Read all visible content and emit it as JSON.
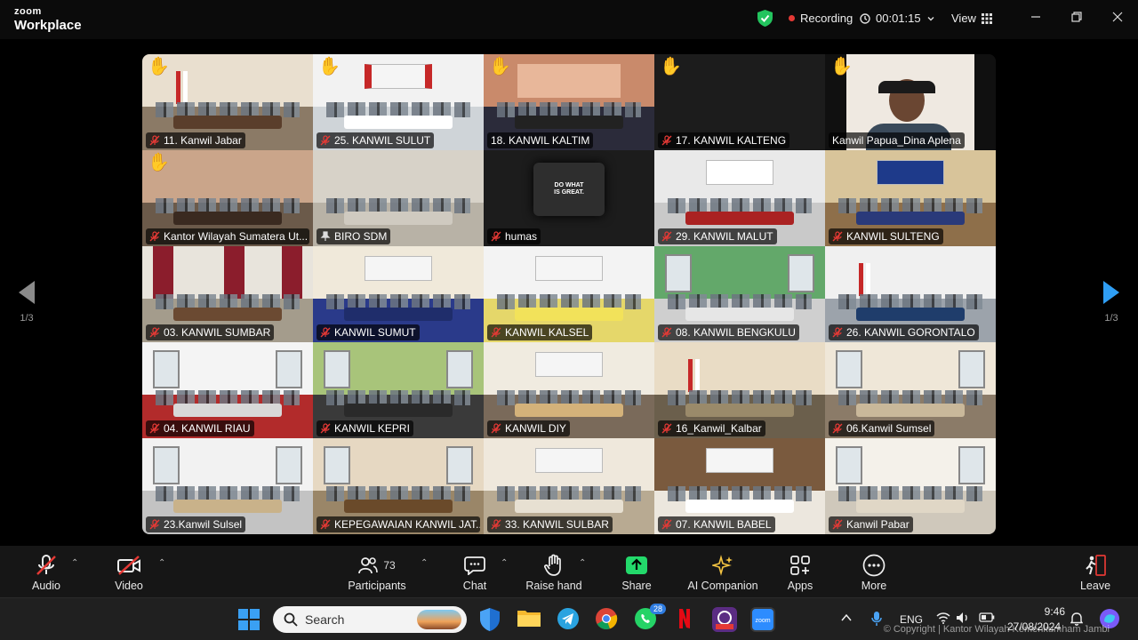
{
  "titlebar": {
    "brand_line1": "zoom",
    "brand_line2": "Workplace",
    "recording_label": "Recording",
    "timer": "00:01:15",
    "view_label": "View"
  },
  "gallery": {
    "pager_left": "1/3",
    "pager_right": "1/3",
    "tiles": [
      {
        "name": "11. Kanwil Jabar",
        "hand": true,
        "muted": true
      },
      {
        "name": "25. KANWIL SULUT",
        "hand": true,
        "muted": true
      },
      {
        "name": "18. KANWIL KALTIM",
        "hand": true,
        "muted": false,
        "active": true
      },
      {
        "name": "17. KANWIL KALTENG",
        "hand": true,
        "muted": true
      },
      {
        "name": "Kanwil Papua_Dina Aplena",
        "hand": true,
        "muted": false
      },
      {
        "name": "Kantor Wilayah Sumatera Ut...",
        "hand": true,
        "muted": true
      },
      {
        "name": "BIRO SDM",
        "hand": false,
        "muted": false,
        "pinned": true
      },
      {
        "name": "humas",
        "hand": false,
        "muted": true
      },
      {
        "name": "29. KANWIL MALUT",
        "hand": false,
        "muted": true
      },
      {
        "name": "KANWIL SULTENG",
        "hand": false,
        "muted": true
      },
      {
        "name": "03. KANWIL SUMBAR",
        "hand": false,
        "muted": true
      },
      {
        "name": "KANWIL SUMUT",
        "hand": false,
        "muted": true
      },
      {
        "name": "KANWIL KALSEL",
        "hand": false,
        "muted": true
      },
      {
        "name": "08. KANWIL BENGKULU",
        "hand": false,
        "muted": true
      },
      {
        "name": "26. KANWIL GORONTALO",
        "hand": false,
        "muted": true
      },
      {
        "name": "04. KANWIL RIAU",
        "hand": false,
        "muted": true
      },
      {
        "name": "KANWIL KEPRI",
        "hand": false,
        "muted": true
      },
      {
        "name": "KANWIL DIY",
        "hand": false,
        "muted": true
      },
      {
        "name": "16_Kanwil_Kalbar",
        "hand": false,
        "muted": true
      },
      {
        "name": "06.Kanwil Sumsel",
        "hand": false,
        "muted": true
      },
      {
        "name": "23.Kanwil Sulsel",
        "hand": false,
        "muted": true
      },
      {
        "name": "KEPEGAWAIAN KANWIL JAT...",
        "hand": false,
        "muted": true
      },
      {
        "name": "33. KANWIL SULBAR",
        "hand": false,
        "muted": true
      },
      {
        "name": "07. KANWIL BABEL",
        "hand": false,
        "muted": true
      },
      {
        "name": "Kanwil Pabar",
        "hand": false,
        "muted": true
      }
    ],
    "humas_screen_text": "DO WHAT IS GREAT."
  },
  "toolbar": {
    "audio": "Audio",
    "video": "Video",
    "participants": "Participants",
    "participants_count": "73",
    "chat": "Chat",
    "raise_hand": "Raise hand",
    "share": "Share",
    "ai_companion": "AI Companion",
    "apps": "Apps",
    "more": "More",
    "leave": "Leave"
  },
  "taskbar": {
    "search_placeholder": "Search",
    "whatsapp_badge": "28",
    "lang": "ENG",
    "time": "9:46",
    "date": "27/08/2024",
    "watermark": "© Copyright | Kantor Wilayah Kemenkumham Jambi"
  },
  "colors": {
    "accent_share": "#23d96b",
    "active_border": "#23d96b",
    "recording_dot": "#e53935",
    "pager_active": "#2f9ef4",
    "raise_hand": "#f7c948"
  }
}
